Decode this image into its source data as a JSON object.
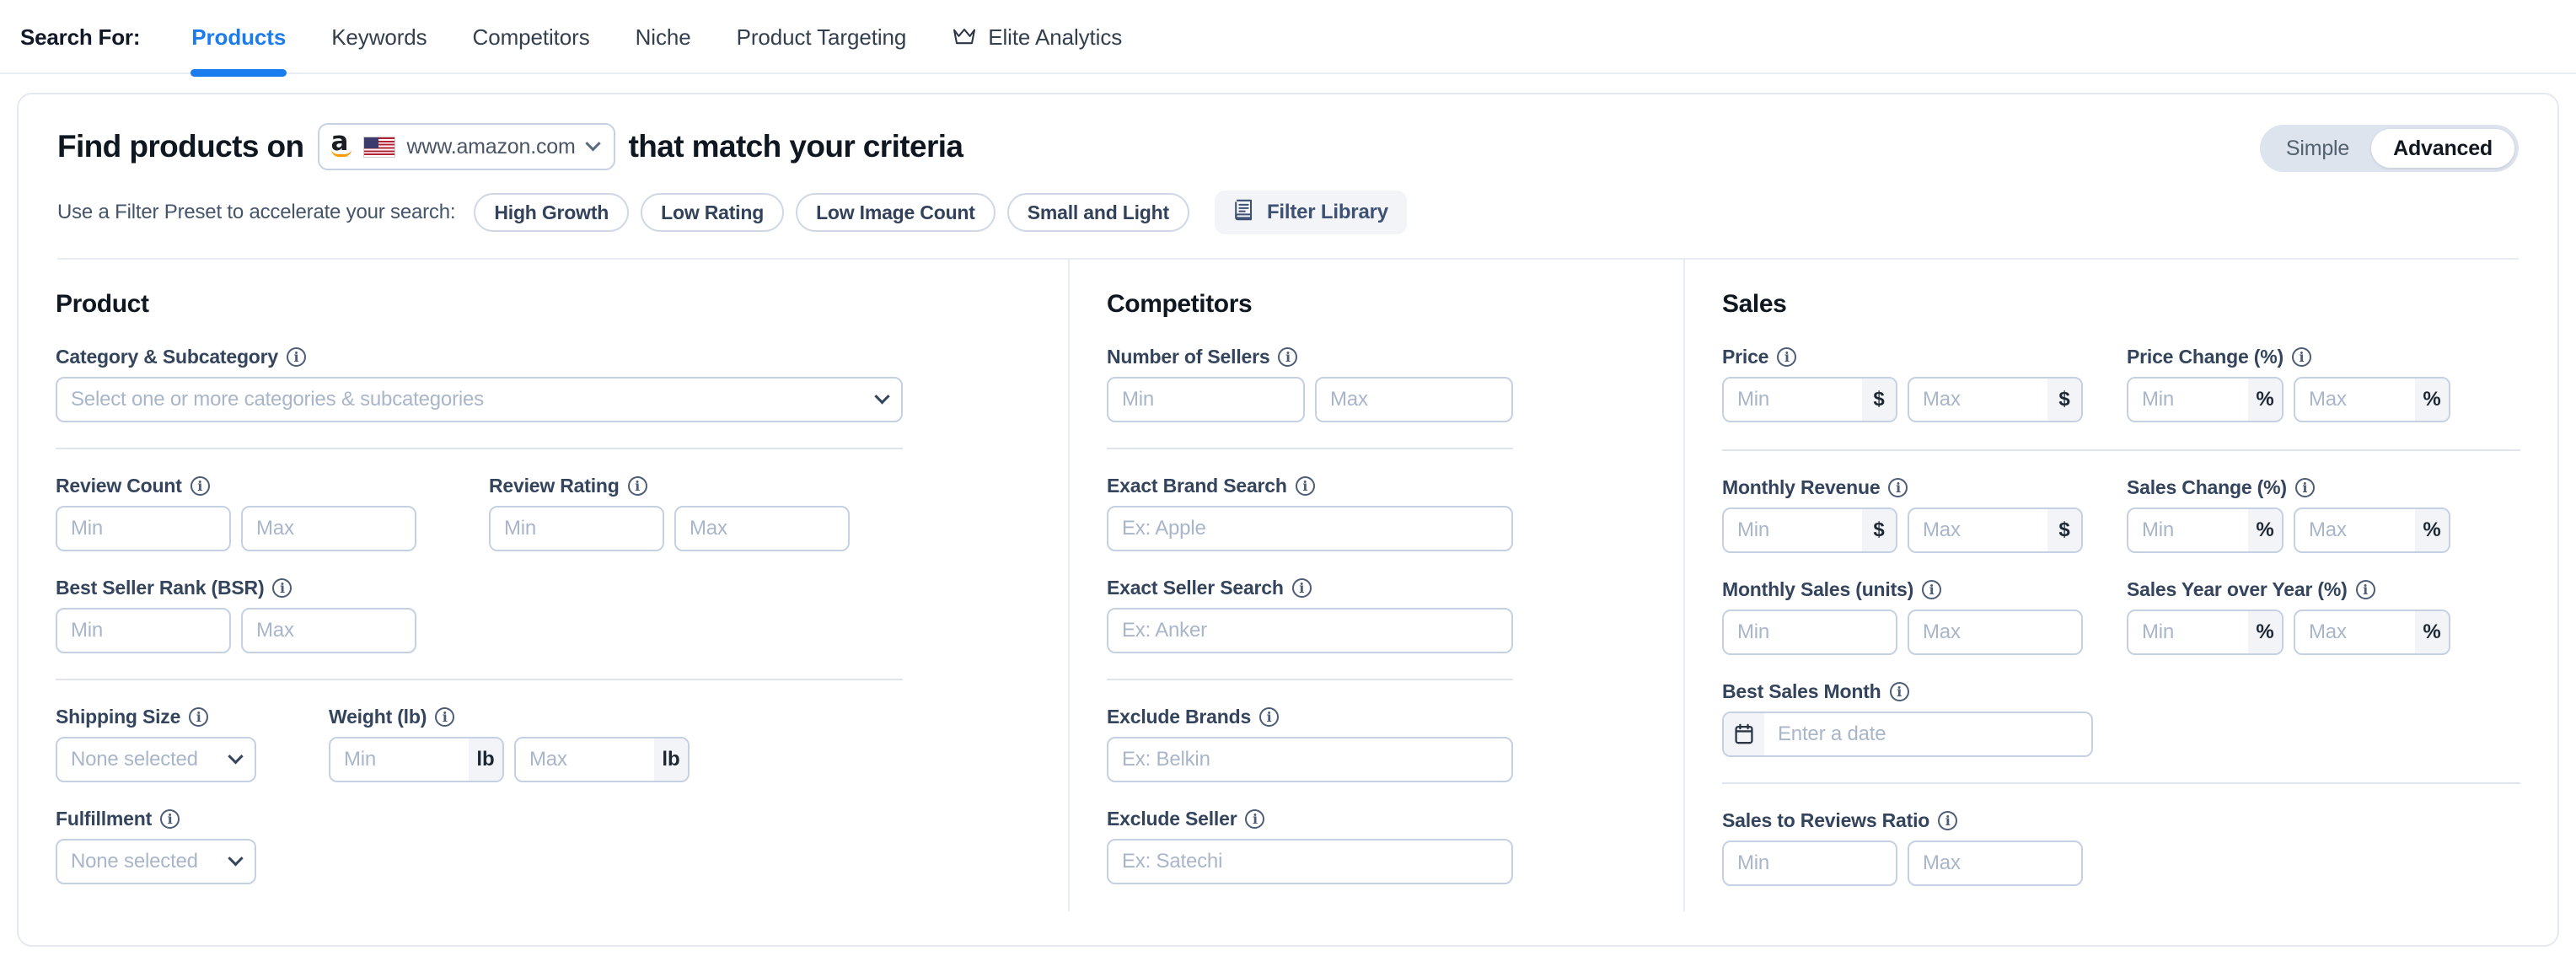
{
  "nav": {
    "search_for_label": "Search For:",
    "tabs": [
      {
        "label": "Products",
        "active": true,
        "icon": null
      },
      {
        "label": "Keywords",
        "active": false,
        "icon": null
      },
      {
        "label": "Competitors",
        "active": false,
        "icon": null
      },
      {
        "label": "Niche",
        "active": false,
        "icon": null
      },
      {
        "label": "Product Targeting",
        "active": false,
        "icon": null
      },
      {
        "label": "Elite Analytics",
        "active": false,
        "icon": "crown-icon"
      }
    ]
  },
  "header": {
    "title_prefix": "Find products on",
    "title_suffix": "that match your criteria",
    "domain": {
      "value": "www.amazon.com",
      "logo": "amazon-logo",
      "flag": "us-flag-icon",
      "chevron": "chevron-down-icon"
    },
    "mode_toggle": {
      "options": [
        "Simple",
        "Advanced"
      ],
      "selected": "Advanced"
    }
  },
  "presets": {
    "label": "Use a Filter Preset to accelerate your search:",
    "items": [
      "High Growth",
      "Low Rating",
      "Low Image Count",
      "Small and Light"
    ],
    "library_button": {
      "label": "Filter Library",
      "icon": "book-icon"
    }
  },
  "columns": {
    "product": {
      "title": "Product",
      "category": {
        "label": "Category & Subcategory",
        "placeholder": "Select one or more categories & subcategories"
      },
      "review_count": {
        "label": "Review Count",
        "min": "Min",
        "max": "Max"
      },
      "review_rating": {
        "label": "Review Rating",
        "min": "Min",
        "max": "Max"
      },
      "bsr": {
        "label": "Best Seller Rank (BSR)",
        "min": "Min",
        "max": "Max"
      },
      "shipping_size": {
        "label": "Shipping Size",
        "placeholder": "None selected"
      },
      "weight": {
        "label": "Weight (lb)",
        "min": "Min",
        "max": "Max",
        "unit": "lb"
      },
      "fulfillment": {
        "label": "Fulfillment",
        "placeholder": "None selected"
      }
    },
    "competitors": {
      "title": "Competitors",
      "number_of_sellers": {
        "label": "Number of Sellers",
        "min": "Min",
        "max": "Max"
      },
      "exact_brand_search": {
        "label": "Exact Brand Search",
        "placeholder": "Ex: Apple"
      },
      "exact_seller_search": {
        "label": "Exact Seller Search",
        "placeholder": "Ex: Anker"
      },
      "exclude_brands": {
        "label": "Exclude Brands",
        "placeholder": "Ex: Belkin"
      },
      "exclude_seller": {
        "label": "Exclude Seller",
        "placeholder": "Ex: Satechi"
      }
    },
    "sales": {
      "title": "Sales",
      "price": {
        "label": "Price",
        "min": "Min",
        "max": "Max",
        "unit": "$"
      },
      "price_change": {
        "label": "Price Change (%)",
        "min": "Min",
        "max": "Max",
        "unit": "%"
      },
      "monthly_revenue": {
        "label": "Monthly Revenue",
        "min": "Min",
        "max": "Max",
        "unit": "$"
      },
      "sales_change": {
        "label": "Sales Change (%)",
        "min": "Min",
        "max": "Max",
        "unit": "%"
      },
      "monthly_sales": {
        "label": "Monthly Sales (units)",
        "min": "Min",
        "max": "Max"
      },
      "sales_yoy": {
        "label": "Sales Year over Year (%)",
        "min": "Min",
        "max": "Max",
        "unit": "%"
      },
      "best_sales_month": {
        "label": "Best Sales Month",
        "placeholder": "Enter a date",
        "icon": "calendar-icon"
      },
      "sales_to_reviews_ratio": {
        "label": "Sales to Reviews Ratio",
        "min": "Min",
        "max": "Max"
      }
    }
  },
  "colors": {
    "accent_blue": "#1a7ced",
    "label_navy": "#33445c",
    "placeholder": "#a9b6ca",
    "border": "#c5d1e2",
    "divider": "#dfe5ef",
    "amazon_orange": "#ff9900"
  }
}
